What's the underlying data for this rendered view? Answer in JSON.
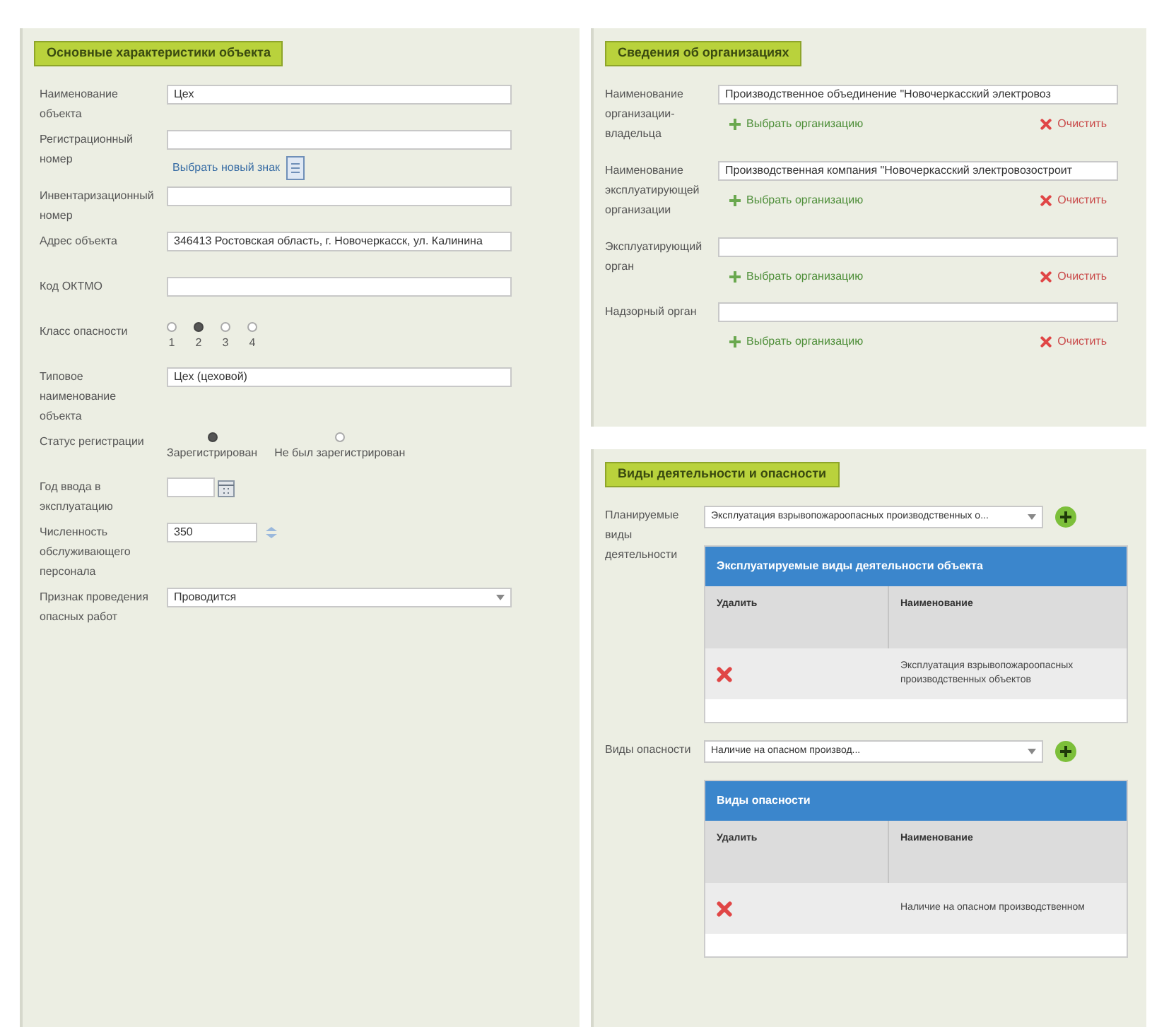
{
  "object_panel": {
    "title": "Основные характеристики объекта",
    "fields": [
      {
        "kind": "text",
        "label": "Наименование объекта",
        "value": "Цех"
      },
      {
        "kind": "text_link",
        "label": "Регистрационный номер",
        "link": "Выбрать новый знак"
      },
      {
        "kind": "text",
        "label": "Инвентаризационный номер"
      },
      {
        "kind": "text",
        "label": "Адрес объекта",
        "value": "346413 Ростовская область, г. Новочеркасск, ул. Калинина"
      },
      {
        "kind": "text",
        "label": "Код ОКТМО"
      },
      {
        "kind": "radios",
        "label": "Класс опасности",
        "options": [
          {
            "label": "1",
            "selected": false
          },
          {
            "label": "2",
            "selected": true
          },
          {
            "label": "3",
            "selected": false
          },
          {
            "label": "4",
            "selected": false
          }
        ]
      },
      {
        "kind": "text",
        "label": "Типовое наименование объекта",
        "value": "Цех (цеховой)"
      },
      {
        "kind": "radios",
        "label": "Статус регистрации",
        "options": [
          {
            "label": "Зарегистрирован",
            "selected": true
          },
          {
            "label": "Не был зарегистрирован",
            "selected": false
          }
        ]
      },
      {
        "kind": "date",
        "label": "Год ввода в эксплуатацию"
      },
      {
        "kind": "number",
        "label": "Численность обслуживающего персонала",
        "value": "350"
      },
      {
        "kind": "select",
        "label": "Признак проведения опасных работ",
        "value": "Проводится"
      }
    ]
  },
  "org_panel": {
    "title": "Сведения об организациях",
    "orgs": [
      {
        "label": "Наименование организации-владельца",
        "value": "Производственное объединение \"Новочеркасский электровоз",
        "pick": "Выбрать организацию",
        "clear": "Очистить"
      },
      {
        "label": "Наименование эксплуатирующей организации",
        "value": "Производственная компания \"Новочеркасский электровозостроит",
        "pick": "Выбрать организацию",
        "clear": "Очистить"
      },
      {
        "label": "Эксплуатирующий орган",
        "pick": "Выбрать организацию",
        "clear": "Очистить"
      },
      {
        "label": "Надзорный орган",
        "pick": "Выбрать организацию",
        "clear": "Очистить"
      }
    ]
  },
  "activity_panel": {
    "title": "Виды деятельности и опасности",
    "groups": [
      {
        "label": "Планируемые виды деятельности",
        "select": "Эксплуатация взрывопожароопасных производственных о...",
        "table": {
          "title": "Эксплуатируемые виды деятельности объекта",
          "columns": [
            "Удалить",
            "Наименование"
          ],
          "rows": [
            {
              "name": "Эксплуатация взрывопожароопасных производственных объектов"
            }
          ]
        }
      },
      {
        "label": "Виды опасности",
        "select": "Наличие на опасном производ...",
        "table": {
          "title": "Виды опасности",
          "columns": [
            "Удалить",
            "Наименование"
          ],
          "rows": [
            {
              "name": "Наличие на опасном производственном"
            }
          ]
        }
      }
    ]
  }
}
